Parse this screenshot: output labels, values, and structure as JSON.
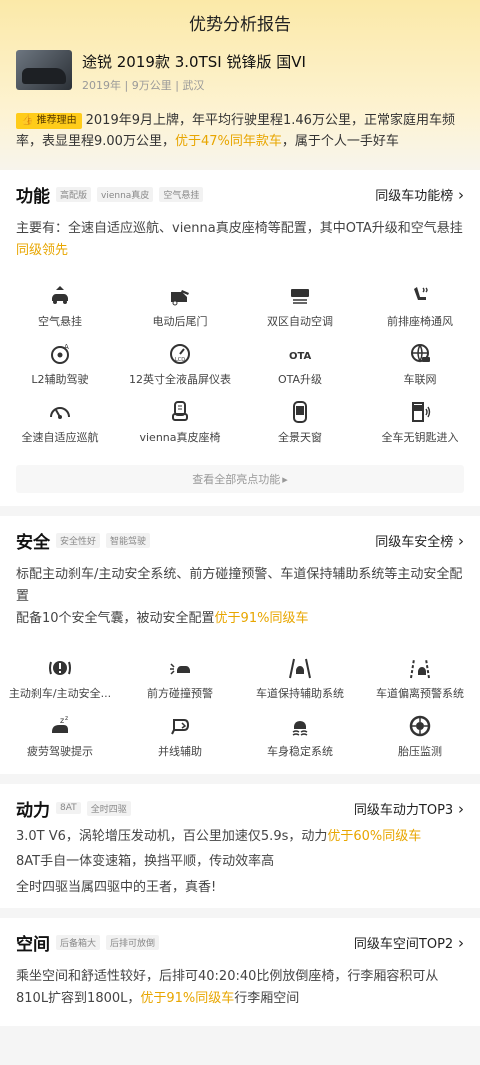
{
  "header": {
    "title": "优势分析报告"
  },
  "car": {
    "title": "途锐 2019款 3.0TSI 锐锋版 国VI",
    "meta": "2019年 | 9万公里 | 武汉"
  },
  "reco": {
    "badge": "推荐理由",
    "text_a": "2019年9月上牌，年平均行驶里程1.46万公里，正常家庭用车频率，表显里程9.00万公里，",
    "highlight": "优于47%同年款车",
    "text_b": "，属于个人一手好车"
  },
  "function": {
    "title": "功能",
    "tags": [
      "高配版",
      "vienna真皮",
      "空气悬挂"
    ],
    "rank": "同级车功能榜",
    "desc_a": "主要有：全速自适应巡航、vienna真皮座椅等配置，其中OTA升级和空气悬挂",
    "desc_hl": "同级领先",
    "features": [
      "空气悬挂",
      "电动后尾门",
      "双区自动空调",
      "前排座椅通风",
      "L2辅助驾驶",
      "12英寸全液晶屏仪表",
      "OTA升级",
      "车联网",
      "全速自适应巡航",
      "vienna真皮座椅",
      "全景天窗",
      "全车无钥匙进入"
    ],
    "ota_glyph": "OTA",
    "more": "查看全部亮点功能"
  },
  "safety": {
    "title": "安全",
    "tags": [
      "安全性好",
      "智能驾驶"
    ],
    "rank": "同级车安全榜",
    "desc1": "标配主动刹车/主动安全系统、前方碰撞预警、车道保持辅助系统等主动安全配置",
    "desc2_a": "配备10个安全气囊，被动安全配置",
    "desc2_hl": "优于91%同级车",
    "features": [
      "主动刹车/主动安全...",
      "前方碰撞预警",
      "车道保持辅助系统",
      "车道偏离预警系统",
      "疲劳驾驶提示",
      "并线辅助",
      "车身稳定系统",
      "胎压监测"
    ]
  },
  "power": {
    "title": "动力",
    "tags": [
      "8AT",
      "全时四驱"
    ],
    "rank": "同级车动力TOP3",
    "line1_a": "3.0T V6，涡轮增压发动机，百公里加速仅5.9s，动力",
    "line1_hl": "优于60%同级车",
    "line2": "8AT手自一体变速箱，换挡平顺，传动效率高",
    "line3": "全时四驱当属四驱中的王者，真香!"
  },
  "space": {
    "title": "空间",
    "tags": [
      "后备箱大",
      "后排可放倒"
    ],
    "rank": "同级车空间TOP2",
    "desc_a": "乘坐空间和舒适性较好，后排可40:20:40比例放倒座椅，行李厢容积可从810L扩容到1800L，",
    "desc_hl": "优于91%同级车",
    "desc_b": "行李厢空间"
  },
  "colors": {
    "accent": "#e8a600",
    "badge": "#ffcc1a"
  }
}
